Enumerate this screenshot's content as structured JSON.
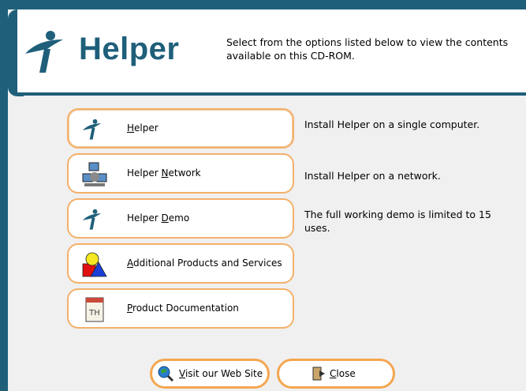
{
  "header": {
    "logo_text": "Helper",
    "description": "Select from the options listed below to view the contents available on this CD-ROM."
  },
  "options": [
    {
      "label": "Helper",
      "underline_index": 0,
      "icon": "helper-logo-icon",
      "description": "Install Helper on a single computer."
    },
    {
      "label": "Helper Network",
      "underline_index": 7,
      "icon": "network-computers-icon",
      "description": "Install Helper on a network."
    },
    {
      "label": "Helper Demo",
      "underline_index": 7,
      "icon": "helper-logo-icon",
      "description": "The full working demo is limited to 15 uses."
    },
    {
      "label": "Additional Products and Services",
      "underline_index": 0,
      "icon": "shapes-icon",
      "description": ""
    },
    {
      "label": "Product Documentation",
      "underline_index": 0,
      "icon": "document-th-icon",
      "description": ""
    }
  ],
  "footer": {
    "website_label": "Visit our Web Site",
    "close_label": "Close"
  },
  "colors": {
    "brand": "#1f5f7a",
    "button_border": "#f4b06a",
    "background": "#f0f0f0"
  }
}
